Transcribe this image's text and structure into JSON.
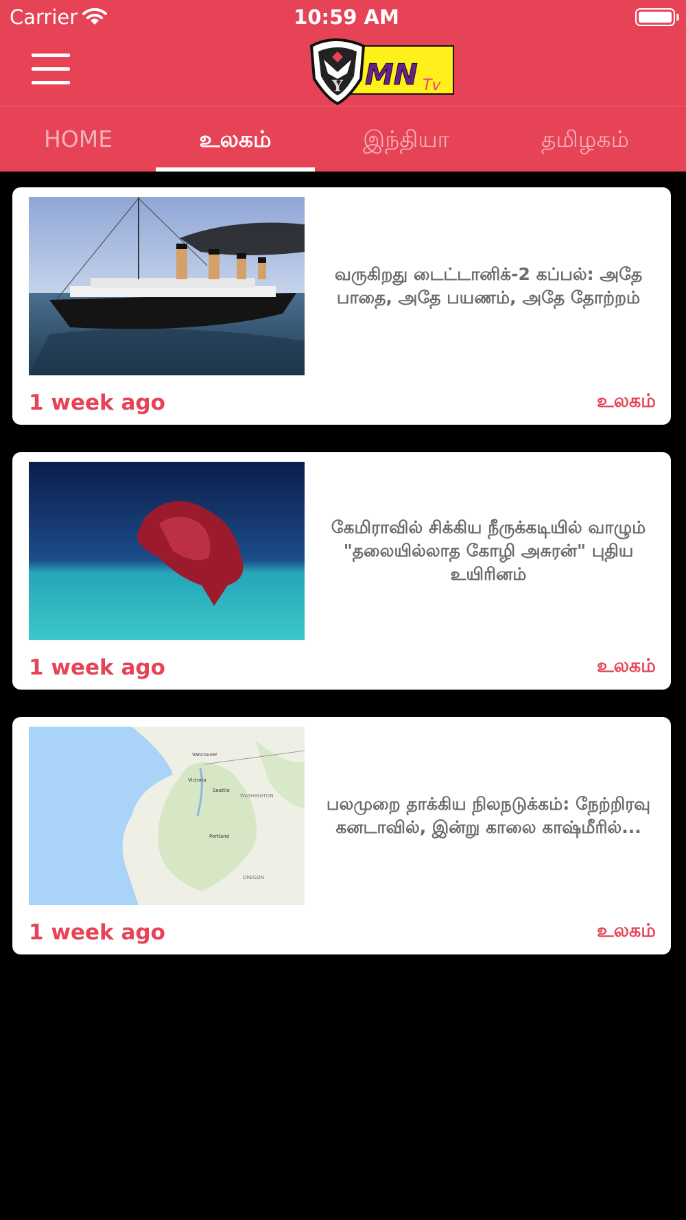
{
  "status_bar": {
    "carrier": "Carrier",
    "time": "10:59 AM"
  },
  "header": {
    "logo_text": "MN",
    "logo_sub": "Tv",
    "logo_letter": "Y",
    "colors": {
      "brand": "#e64356",
      "logo_yellow": "#ffef1a"
    }
  },
  "tabs": [
    {
      "label": "HOME",
      "active": false
    },
    {
      "label": "உலகம்",
      "active": true
    },
    {
      "label": "இந்தியா",
      "active": false
    },
    {
      "label": "தமிழகம்",
      "active": false
    }
  ],
  "articles": [
    {
      "image": "titanic-ship-image",
      "title": "வருகிறது டைட்டானிக்-2 கப்பல்: அதே பாதை, அதே பயணம், அதே தோற்றம்",
      "time_ago": "1 week ago",
      "category": "உலகம்"
    },
    {
      "image": "sea-creature-image",
      "title": "கேமிராவில் சிக்கிய நீருக்கடியில் வாழும் \"தலையில்லாத கோழி அசுரன்\" புதிய உயிரினம்",
      "time_ago": "1 week ago",
      "category": "உலகம்"
    },
    {
      "image": "map-image",
      "title": "பலமுறை தாக்கிய நிலநடுக்கம்: நேற்றிரவு கனடாவில், இன்று காலை காஷ்மீரில்...",
      "time_ago": "1 week ago",
      "category": "உலகம்",
      "map_labels": {
        "vancouver": "Vancouver",
        "victoria": "Victoria",
        "seattle": "Seattle",
        "washington": "WASHINGTON",
        "portland": "Portland",
        "oregon": "OREGON"
      }
    }
  ]
}
